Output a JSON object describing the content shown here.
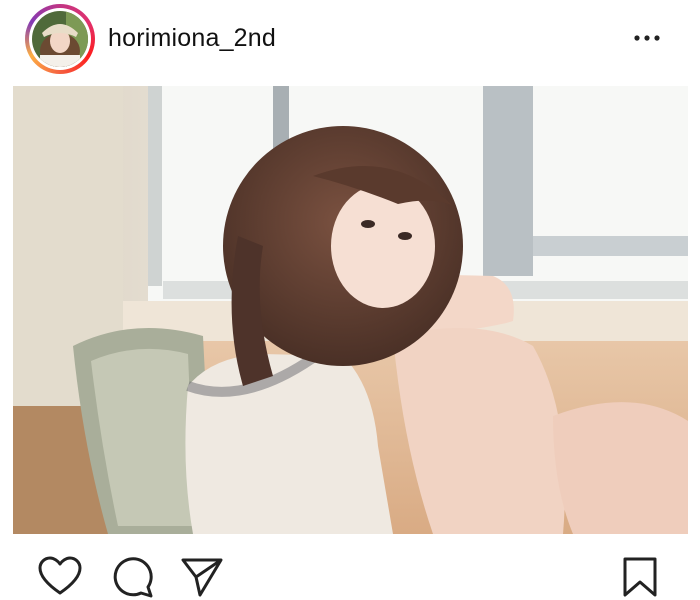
{
  "post": {
    "username": "horimiona_2nd",
    "avatar": "profile-photo",
    "more_icon": "more-horizontal-icon",
    "photo": "photo-girl-seated-by-window"
  },
  "actions": {
    "like_icon": "heart-icon",
    "comment_icon": "comment-bubble-icon",
    "share_icon": "send-paper-plane-icon",
    "save_icon": "bookmark-icon"
  },
  "colors": {
    "text": "#111111",
    "ring_gradient": [
      "#c13584",
      "#fd1d1d",
      "#fcaf45",
      "#833ab4"
    ]
  }
}
